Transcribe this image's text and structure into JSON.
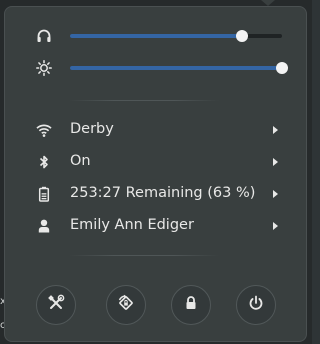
{
  "volume": {
    "icon": "headphones-icon",
    "level": 0.81
  },
  "brightness": {
    "icon": "brightness-icon",
    "level": 1.0
  },
  "items": [
    {
      "icon": "wifi-icon",
      "label": "Derby"
    },
    {
      "icon": "bluetooth-icon",
      "label": "On"
    },
    {
      "icon": "battery-icon",
      "label": "253:27 Remaining (63 %)"
    },
    {
      "icon": "user-icon",
      "label": "Emily Ann Ediger"
    }
  ],
  "actions": [
    {
      "icon": "settings-tools-icon",
      "name": "settings"
    },
    {
      "icon": "rotation-lock-icon",
      "name": "orientation-lock"
    },
    {
      "icon": "lock-icon",
      "name": "lock-screen"
    },
    {
      "icon": "power-icon",
      "name": "power-off"
    }
  ],
  "colors": {
    "accent": "#3465a4",
    "menu_bg": "#393f3f",
    "text": "#e8e8e7"
  }
}
